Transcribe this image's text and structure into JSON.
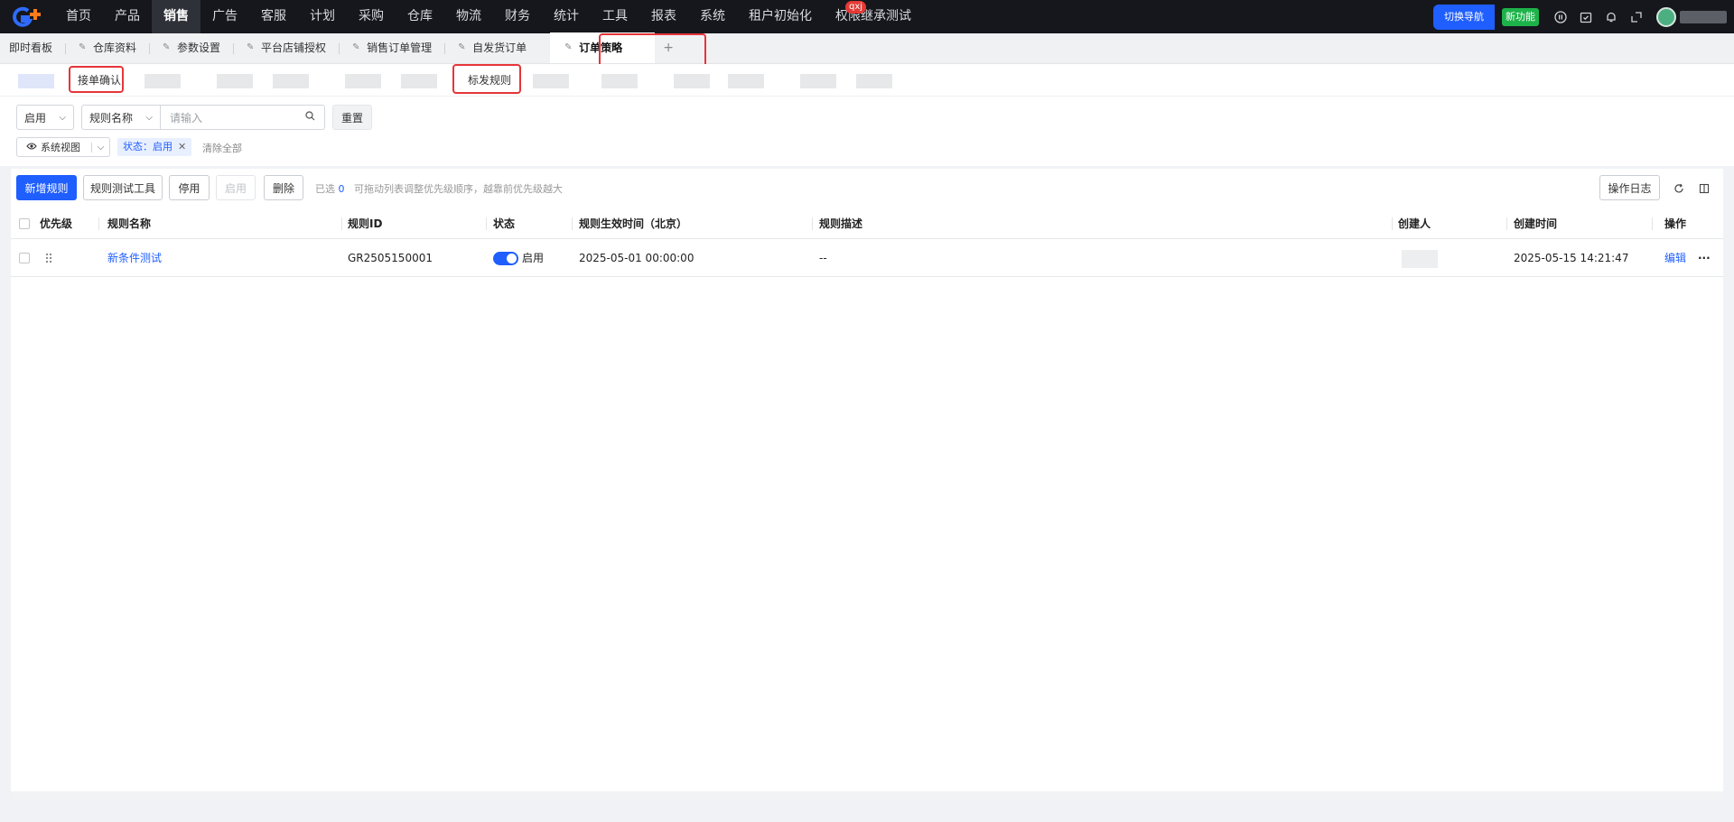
{
  "topnav": {
    "items": [
      "首页",
      "产品",
      "销售",
      "广告",
      "客服",
      "计划",
      "采购",
      "仓库",
      "物流",
      "财务",
      "统计",
      "工具",
      "报表",
      "系统",
      "租户初始化",
      "权限继承测试"
    ],
    "active": "销售",
    "badge": "qxj",
    "switch_nav": "切换导航",
    "new_feature": "新功能"
  },
  "tabs": {
    "items": [
      "即时看板",
      "仓库资料",
      "参数设置",
      "平台店铺授权",
      "销售订单管理",
      "自发货订单",
      "订单策略"
    ],
    "active": "订单策略",
    "add": "+"
  },
  "subtabs": {
    "order_confirm": "接单确认",
    "mark_ship_rule": "标发规则"
  },
  "filters": {
    "status_select": "启用",
    "field_select": "规则名称",
    "search_placeholder": "请输入",
    "reset": "重置",
    "view": "系统视图",
    "tag_label": "状态：",
    "tag_value": "启用",
    "clear_all": "清除全部"
  },
  "toolbar": {
    "add_rule": "新增规则",
    "test_tool": "规则测试工具",
    "disable": "停用",
    "enable": "启用",
    "delete": "删除",
    "selected_label": "已选",
    "selected_count": "0",
    "hint": "可拖动列表调整优先级顺序，越靠前优先级越大",
    "op_log": "操作日志"
  },
  "table": {
    "columns": [
      "优先级",
      "规则名称",
      "规则ID",
      "状态",
      "规则生效时间（北京）",
      "规则描述",
      "创建人",
      "创建时间",
      "操作"
    ],
    "rows": [
      {
        "name": "新条件测试",
        "id": "GR2505150001",
        "status": "启用",
        "effective_time": "2025-05-01 00:00:00",
        "description": "--",
        "created_at": "2025-05-15 14:21:47",
        "edit": "编辑",
        "more": "···"
      }
    ]
  },
  "colors": {
    "primary": "#1f5eff",
    "nav_bg": "#15171c",
    "highlight": "#e5353a",
    "new_feature": "#1db34a"
  }
}
